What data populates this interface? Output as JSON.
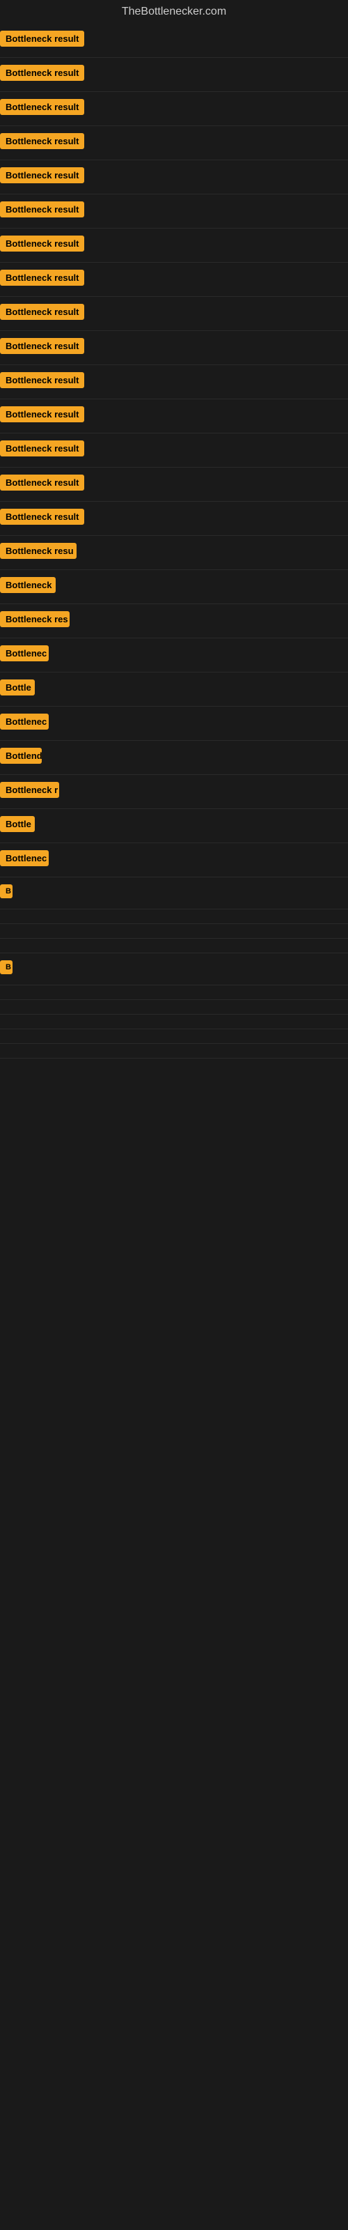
{
  "site": {
    "title": "TheBottlenecker.com"
  },
  "rows": [
    {
      "id": 1,
      "label": "Bottleneck result",
      "width": 135
    },
    {
      "id": 2,
      "label": "Bottleneck result",
      "width": 135
    },
    {
      "id": 3,
      "label": "Bottleneck result",
      "width": 135
    },
    {
      "id": 4,
      "label": "Bottleneck result",
      "width": 135
    },
    {
      "id": 5,
      "label": "Bottleneck result",
      "width": 135
    },
    {
      "id": 6,
      "label": "Bottleneck result",
      "width": 135
    },
    {
      "id": 7,
      "label": "Bottleneck result",
      "width": 135
    },
    {
      "id": 8,
      "label": "Bottleneck result",
      "width": 135
    },
    {
      "id": 9,
      "label": "Bottleneck result",
      "width": 135
    },
    {
      "id": 10,
      "label": "Bottleneck result",
      "width": 135
    },
    {
      "id": 11,
      "label": "Bottleneck result",
      "width": 135
    },
    {
      "id": 12,
      "label": "Bottleneck result",
      "width": 135
    },
    {
      "id": 13,
      "label": "Bottleneck result",
      "width": 135
    },
    {
      "id": 14,
      "label": "Bottleneck result",
      "width": 135
    },
    {
      "id": 15,
      "label": "Bottleneck result",
      "width": 135
    },
    {
      "id": 16,
      "label": "Bottleneck resu",
      "width": 110
    },
    {
      "id": 17,
      "label": "Bottleneck",
      "width": 80
    },
    {
      "id": 18,
      "label": "Bottleneck res",
      "width": 100
    },
    {
      "id": 19,
      "label": "Bottlenec",
      "width": 70
    },
    {
      "id": 20,
      "label": "Bottle",
      "width": 50
    },
    {
      "id": 21,
      "label": "Bottlenec",
      "width": 70
    },
    {
      "id": 22,
      "label": "Bottlend",
      "width": 60
    },
    {
      "id": 23,
      "label": "Bottleneck r",
      "width": 85
    },
    {
      "id": 24,
      "label": "Bottle",
      "width": 50
    },
    {
      "id": 25,
      "label": "Bottlenec",
      "width": 70
    },
    {
      "id": 26,
      "label": "B",
      "width": 18
    },
    {
      "id": 27,
      "label": "",
      "width": 0
    },
    {
      "id": 28,
      "label": "",
      "width": 0
    },
    {
      "id": 29,
      "label": "",
      "width": 0
    },
    {
      "id": 30,
      "label": "B",
      "width": 18
    },
    {
      "id": 31,
      "label": "",
      "width": 0
    },
    {
      "id": 32,
      "label": "",
      "width": 0
    },
    {
      "id": 33,
      "label": "",
      "width": 0
    },
    {
      "id": 34,
      "label": "",
      "width": 0
    },
    {
      "id": 35,
      "label": "",
      "width": 0
    }
  ],
  "colors": {
    "badge_bg": "#f5a623",
    "badge_text": "#000000",
    "background": "#1a1a1a",
    "title_text": "#cccccc"
  }
}
